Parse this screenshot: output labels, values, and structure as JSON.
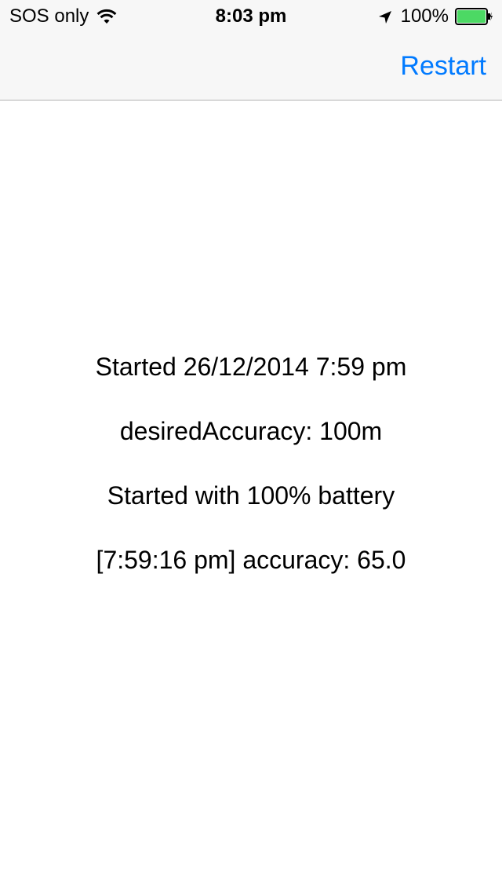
{
  "status_bar": {
    "carrier": "SOS only",
    "time": "8:03 pm",
    "battery_percent": "100%",
    "battery_level": 1.0,
    "battery_color": "#4cd964",
    "icons": [
      "wifi-icon",
      "location-arrow-icon",
      "battery-icon"
    ]
  },
  "nav_bar": {
    "restart_label": "Restart",
    "accent_color": "#007aff"
  },
  "log": {
    "lines": [
      "Started 26/12/2014 7:59 pm",
      "desiredAccuracy: 100m",
      "Started with 100% battery",
      "[7:59:16 pm] accuracy: 65.0"
    ]
  }
}
